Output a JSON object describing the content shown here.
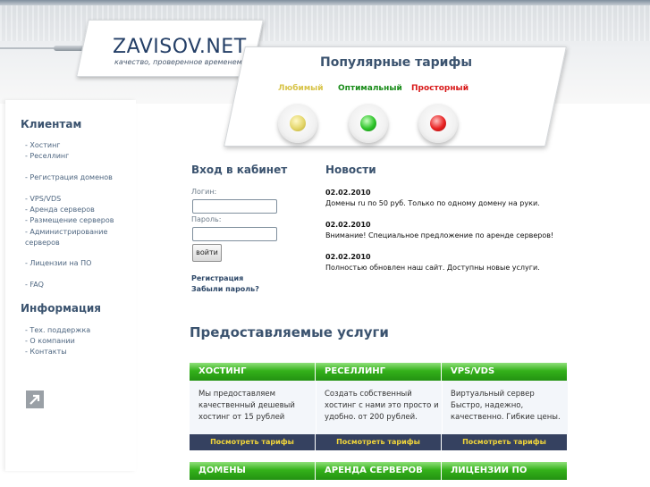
{
  "header": {
    "logo_title": "ZAVISOV.NET",
    "logo_subtitle": "качество, проверенное временем"
  },
  "tariffs": {
    "title": "Популярные тарифы",
    "items": [
      {
        "label": "Любимый",
        "color": "#d8c44a"
      },
      {
        "label": "Оптимальный",
        "color": "#1ea31e"
      },
      {
        "label": "Просторный",
        "color": "#e01818"
      }
    ]
  },
  "sidebar": {
    "clients_heading": "Клиентам",
    "clients_links": [
      "- Хостинг",
      "- Реселлинг",
      "- Регистрация доменов",
      "- VPS/VDS",
      "- Аренда серверов",
      "- Размещение серверов",
      "- Администрирование серверов",
      "- Лицензии на ПО",
      "- FAQ"
    ],
    "info_heading": "Информация",
    "info_links": [
      "- Тех. поддержка",
      "- О компании",
      "- Контакты"
    ]
  },
  "login": {
    "title": "Вход в кабинет",
    "login_label": "Логин:",
    "password_label": "Пароль:",
    "submit": "войти",
    "register": "Регистрация",
    "forgot": "Забыли пароль?"
  },
  "news": {
    "title": "Новости",
    "items": [
      {
        "date": "02.02.2010",
        "text": "Домены ru по 50 руб. Только по одному домену на руки."
      },
      {
        "date": "02.02.2010",
        "text": "Внимание! Специальное предложение по аренде серверов!"
      },
      {
        "date": "02.02.2010",
        "text": "Полностью обновлен наш сайт. Доступны новые услуги."
      }
    ]
  },
  "services": {
    "title": "Предоставляемые услуги",
    "row1": [
      {
        "name": "ХОСТИНГ",
        "desc": [
          "Мы предоставляем",
          "качественный дешевый",
          "хостинг от 15 рублей"
        ],
        "link": "Посмотреть тарифы"
      },
      {
        "name": "РЕСЕЛЛИНГ",
        "desc": [
          "Создать собственный",
          "хостинг с нами это просто и",
          "удобно. от 200 рублей."
        ],
        "link": "Посмотреть тарифы"
      },
      {
        "name": "VPS/VDS",
        "desc": [
          "Виртуальный сервер",
          "Быстро, надежно,",
          "качественно. Гибкие цены."
        ],
        "link": "Посмотреть тарифы"
      }
    ],
    "row2": [
      {
        "name": "ДОМЕНЫ"
      },
      {
        "name": "АРЕНДА СЕРВЕРОВ"
      },
      {
        "name": "ЛИЦЕНЗИИ ПО"
      }
    ]
  }
}
